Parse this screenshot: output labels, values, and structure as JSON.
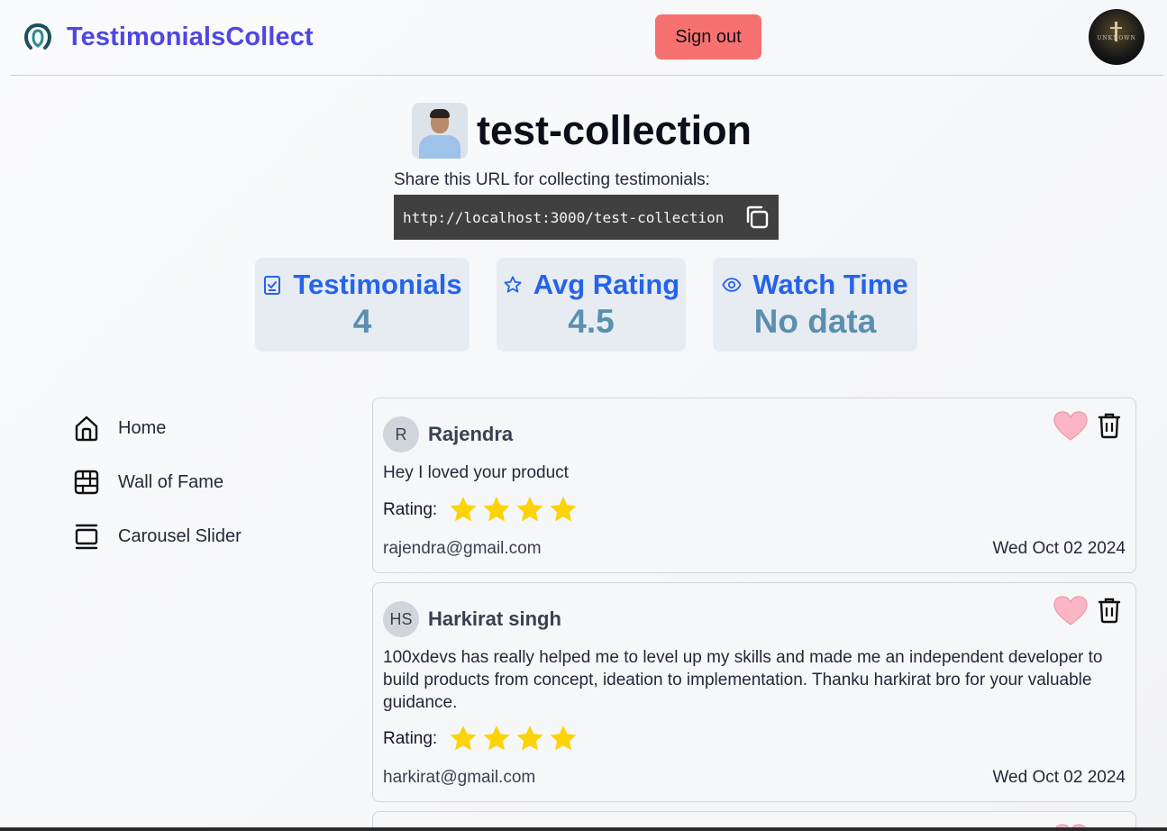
{
  "header": {
    "brand": "TestimonialsCollect",
    "sign_out": "Sign out",
    "avatar_tag": "UNKNOWN"
  },
  "collection": {
    "name": "test-collection",
    "share_label": "Share this URL for collecting testimonials:",
    "url": "http://localhost:3000/test-collection"
  },
  "stats": [
    {
      "label": "Testimonials",
      "value": "4",
      "icon": "clipboard-check-icon"
    },
    {
      "label": "Avg Rating",
      "value": "4.5",
      "icon": "star-outline-icon"
    },
    {
      "label": "Watch Time",
      "value": "No data",
      "icon": "eye-icon"
    }
  ],
  "sidebar": {
    "items": [
      {
        "label": "Home",
        "icon": "home-icon"
      },
      {
        "label": "Wall of Fame",
        "icon": "grid-icon"
      },
      {
        "label": "Carousel Slider",
        "icon": "carousel-icon"
      }
    ]
  },
  "testimonials": [
    {
      "initials": "R",
      "name": "Rajendra",
      "text": "Hey I loved your product",
      "rating_label": "Rating:",
      "rating": 4,
      "email": "rajendra@gmail.com",
      "date": "Wed Oct 02 2024"
    },
    {
      "initials": "HS",
      "name": "Harkirat singh",
      "text": "100xdevs has really helped me to level up my skills and made me an independent developer to build products from concept, ideation to implementation. Thanku harkirat bro for your valuable guidance.",
      "rating_label": "Rating:",
      "rating": 4,
      "email": "harkirat@gmail.com",
      "date": "Wed Oct 02 2024"
    }
  ],
  "colors": {
    "brand": "#4f46e5",
    "sign_out_bg": "#f87171",
    "stat_label": "#2563eb",
    "stat_value": "#5b8fae",
    "star": "#fcd307",
    "heart": "#fbb6c6"
  }
}
